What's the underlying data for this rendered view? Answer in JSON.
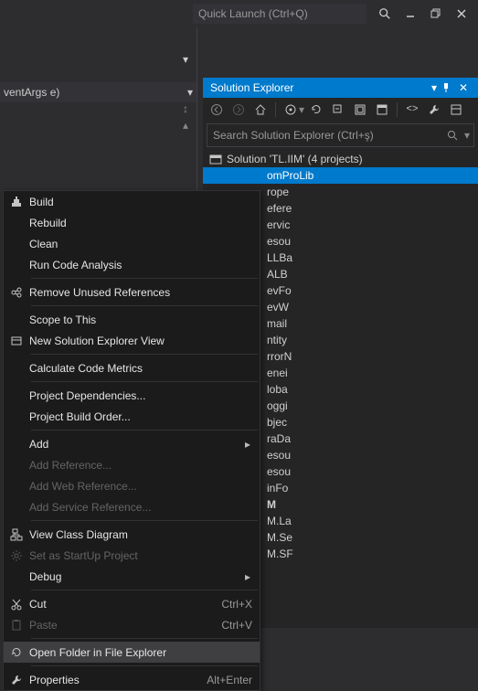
{
  "titlebar": {
    "quicklaunch_placeholder": "Quick Launch (Ctrl+Q)"
  },
  "code_header": {
    "text": "ventArgs e)"
  },
  "panel": {
    "title": "Solution Explorer",
    "search_placeholder": "Search Solution Explorer (Ctrl+ş)",
    "solution_label": "Solution 'TL.IIM' (4 projects)",
    "selected_project": "omProLib",
    "items": [
      "rope",
      "efere",
      "ervic",
      "esou",
      "LLBa",
      "ALB",
      "evFo",
      "evW",
      "mail",
      "ntity",
      "rrorN",
      "enei",
      "loba",
      "oggi",
      "bjec",
      "raDa",
      "esou",
      "esou",
      "inFo"
    ],
    "bold_item": "M",
    "tail_items": [
      "M.La",
      "M.Se",
      "M.SF"
    ]
  },
  "menu": {
    "items": [
      {
        "icon": "build",
        "label": "Build"
      },
      {
        "label": "Rebuild"
      },
      {
        "label": "Clean"
      },
      {
        "label": "Run Code Analysis"
      },
      {
        "sep": true
      },
      {
        "icon": "refs",
        "label": "Remove Unused References"
      },
      {
        "sep": true
      },
      {
        "label": "Scope to This"
      },
      {
        "icon": "newview",
        "label": "New Solution Explorer View"
      },
      {
        "sep": true
      },
      {
        "label": "Calculate Code Metrics"
      },
      {
        "sep": true
      },
      {
        "label": "Project Dependencies..."
      },
      {
        "label": "Project Build Order..."
      },
      {
        "sep": true
      },
      {
        "label": "Add",
        "arrow": true
      },
      {
        "label": "Add Reference...",
        "disabled": true
      },
      {
        "label": "Add Web Reference...",
        "disabled": true
      },
      {
        "label": "Add Service Reference...",
        "disabled": true
      },
      {
        "sep": true
      },
      {
        "icon": "class",
        "label": "View Class Diagram"
      },
      {
        "icon": "gear",
        "label": "Set as StartUp Project",
        "disabled": true
      },
      {
        "label": "Debug",
        "arrow": true
      },
      {
        "sep": true
      },
      {
        "icon": "cut",
        "label": "Cut",
        "shortcut": "Ctrl+X"
      },
      {
        "icon": "paste",
        "label": "Paste",
        "shortcut": "Ctrl+V",
        "disabled": true
      },
      {
        "sep": true
      },
      {
        "icon": "open",
        "label": "Open Folder in File Explorer",
        "hover": true
      },
      {
        "sep": true
      },
      {
        "icon": "wrench",
        "label": "Properties",
        "shortcut": "Alt+Enter"
      }
    ]
  }
}
